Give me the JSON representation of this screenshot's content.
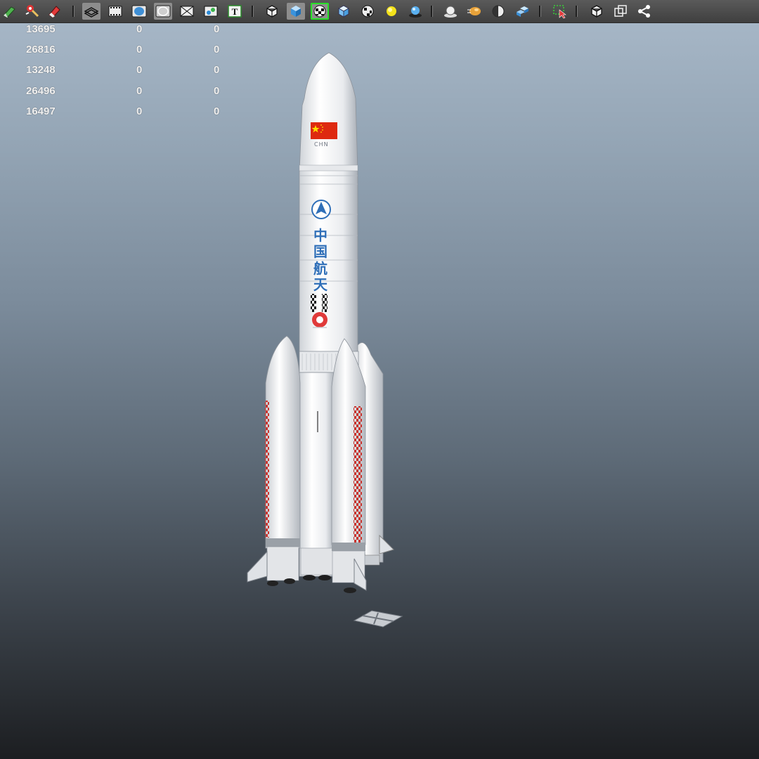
{
  "toolbar": {
    "tools": [
      {
        "icon": "modeling-toolkit-icon"
      },
      {
        "icon": "sculpt-brush-icon"
      },
      {
        "icon": "eraser-icon"
      },
      {
        "icon": "wireframe-shade-icon"
      },
      {
        "icon": "film-gate-icon"
      },
      {
        "icon": "smooth-shade-icon"
      },
      {
        "icon": "xray-shade-icon"
      },
      {
        "icon": "backface-culling-icon"
      },
      {
        "icon": "uv-texture-icon"
      },
      {
        "icon": "text-tool-icon",
        "label": "T"
      },
      {
        "icon": "wireframe-cube-icon"
      },
      {
        "icon": "shaded-cube-icon"
      },
      {
        "icon": "checker-texture-icon",
        "highlighted": true
      },
      {
        "icon": "textured-cube-icon"
      },
      {
        "icon": "checker-ball-icon"
      },
      {
        "icon": "default-light-icon"
      },
      {
        "icon": "shadows-sphere-icon"
      },
      {
        "icon": "ambient-occlusion-icon"
      },
      {
        "icon": "motion-blur-icon"
      },
      {
        "icon": "half-sphere-icon"
      },
      {
        "icon": "isolate-select-icon"
      },
      {
        "icon": "selection-marquee-icon"
      },
      {
        "icon": "bounding-box-icon"
      },
      {
        "icon": "frame-all-icon"
      },
      {
        "icon": "share-icon"
      }
    ]
  },
  "hud": {
    "rows": [
      [
        "13695",
        "0",
        "0"
      ],
      [
        "26816",
        "0",
        "0"
      ],
      [
        "13248",
        "0",
        "0"
      ],
      [
        "26496",
        "0",
        "0"
      ],
      [
        "16497",
        "0",
        "0"
      ]
    ]
  },
  "viewport": {
    "background_top": "#a9b9c9",
    "background_bottom": "#1c1e21",
    "rocket": {
      "flag_label": "CHN",
      "logo_chars": [
        "中",
        "国",
        "航",
        "天"
      ],
      "flag_color": "#de2910",
      "star_color": "#ffde00",
      "text_color": "#2f6fb8",
      "checker_color": "#c8342f"
    }
  }
}
